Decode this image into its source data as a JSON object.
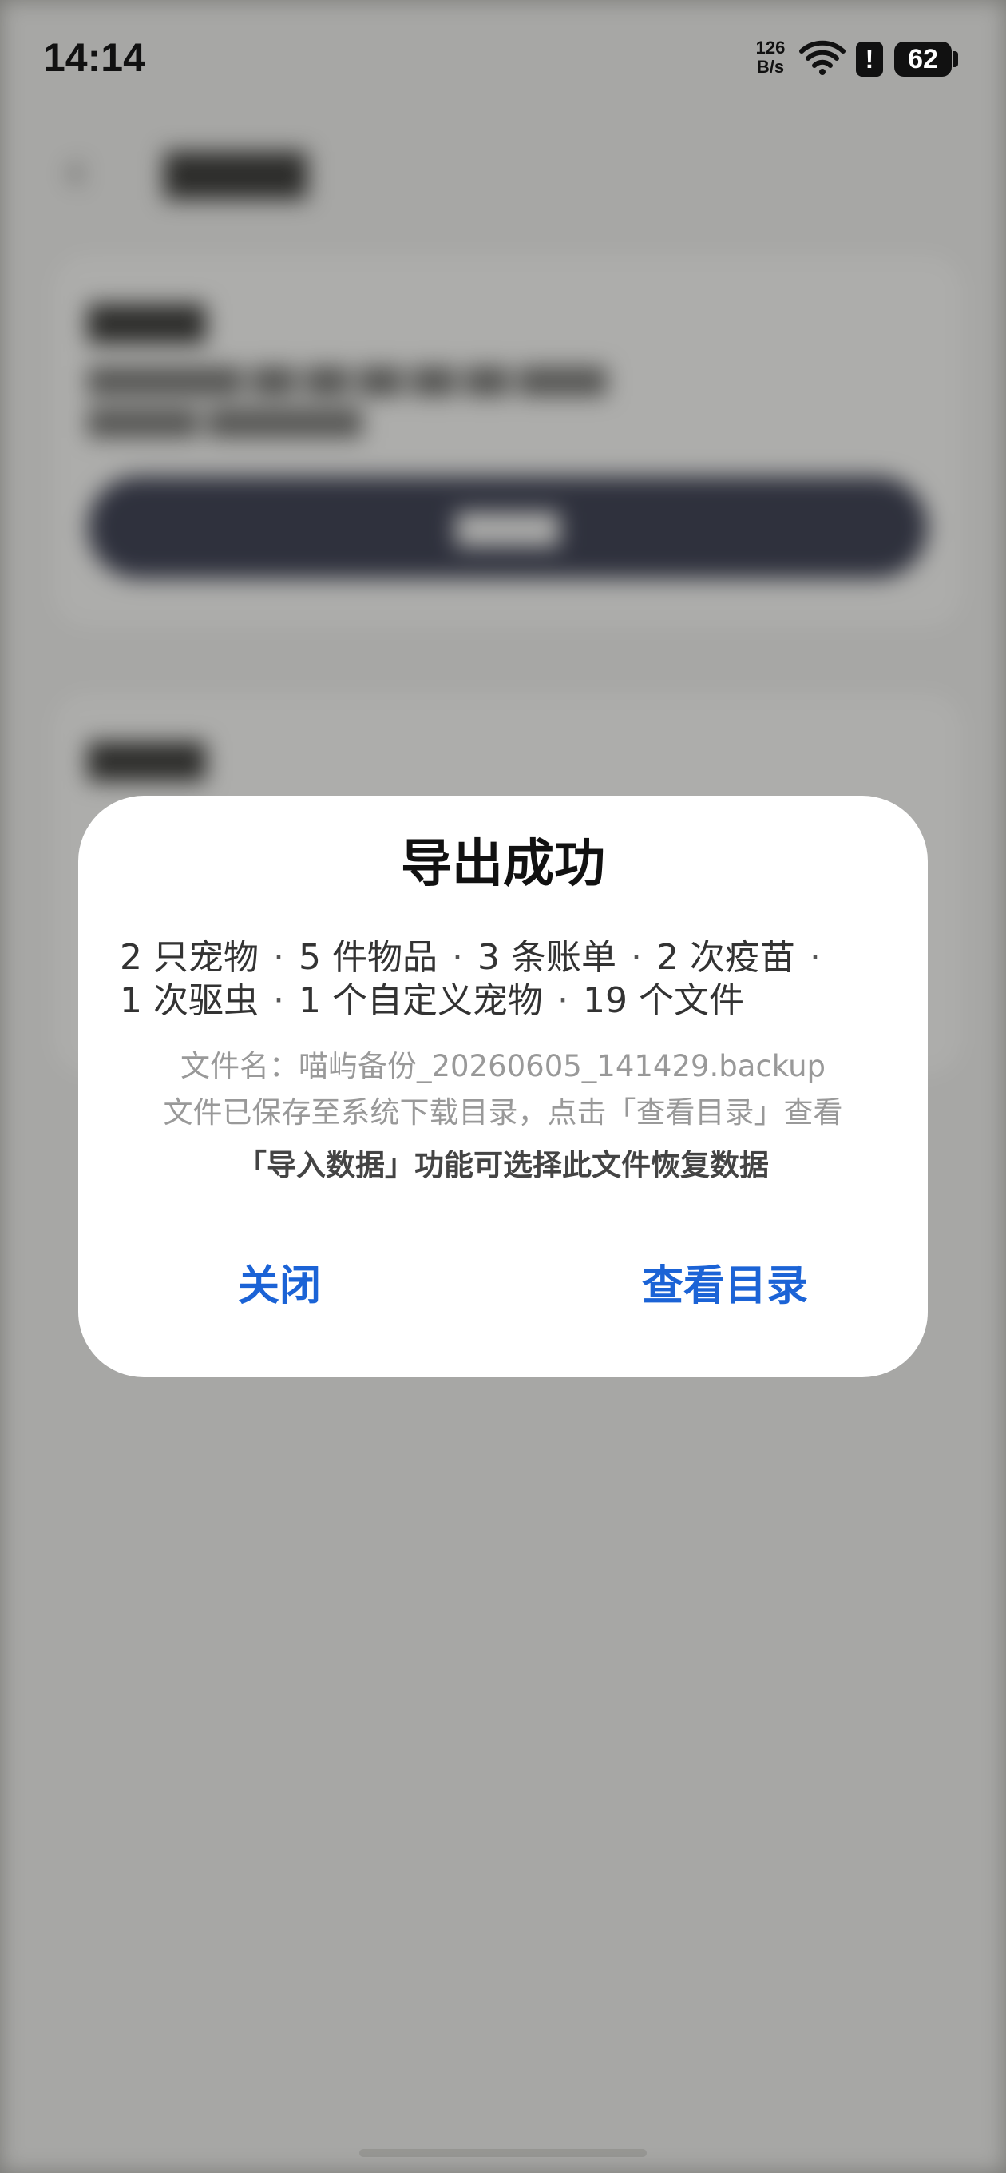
{
  "status_bar": {
    "time": "14:14",
    "net_speed_value": "126",
    "net_speed_unit": "B/s",
    "alert_glyph": "!",
    "battery_level": "62",
    "icons": [
      "wifi-icon",
      "alert-icon",
      "battery-icon"
    ]
  },
  "dialog": {
    "title": "导出成功",
    "summary_line1": [
      "2 只宠物",
      "5 件物品",
      "3 条账单",
      "2 次疫苗"
    ],
    "summary_line2": [
      "1 次驱虫",
      "1 个自定义宠物",
      "19 个文件"
    ],
    "separator": "·",
    "file_name": "文件名：喵屿备份_20260605_141429.backup",
    "save_hint": "文件已保存至系统下载目录，点击「查看目录」查看",
    "import_hint": "「导入数据」功能可选择此文件恢复数据",
    "close_label": "关闭",
    "view_dir_label": "查看目录"
  },
  "colors": {
    "accent": "#1b63d6",
    "scrim": "#a5a5a2",
    "dialog_bg": "#ffffff"
  }
}
